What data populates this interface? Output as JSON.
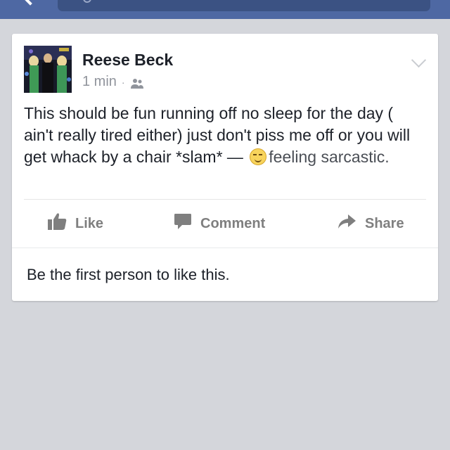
{
  "header": {
    "back_icon": "chevron-left-icon",
    "search_icon": "search-icon",
    "background": "#4e68a3"
  },
  "post": {
    "author": "Reese Beck",
    "time": "1 min",
    "separator": "·",
    "audience_icon": "friends-icon",
    "menu_icon": "chevron-down-icon",
    "text": "This should be fun running off no sleep for the day ( ain't really tired either) just don't piss me off or you will get whack by a chair *slam* —",
    "feeling_icon": "smirk-emoji-icon",
    "feeling": "feeling sarcastic."
  },
  "actions": {
    "like": "Like",
    "comment": "Comment",
    "share": "Share"
  },
  "likes_summary": "Be the first person to like this.",
  "colors": {
    "page_background": "#d4d6db",
    "card_background": "#ffffff",
    "action_text": "#7f7f7f",
    "meta_text": "#90949c"
  }
}
